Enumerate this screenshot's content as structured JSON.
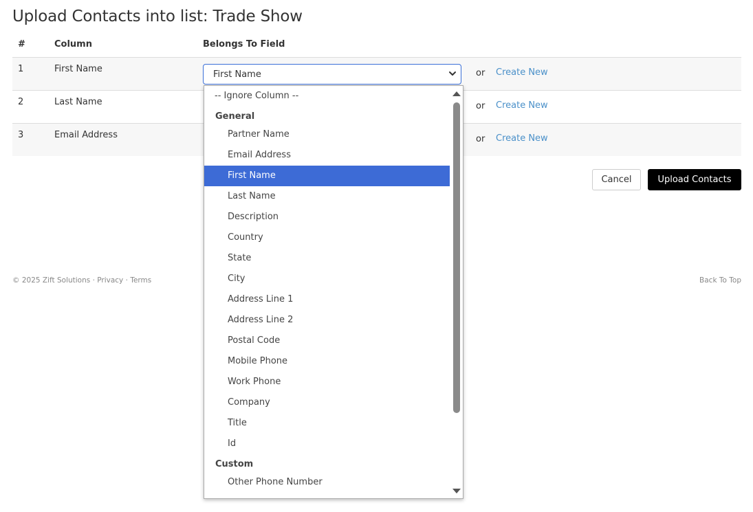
{
  "page": {
    "title": "Upload Contacts into list: Trade Show"
  },
  "table": {
    "headers": {
      "num": "#",
      "column": "Column",
      "field": "Belongs To Field"
    },
    "rows": [
      {
        "num": "1",
        "column": "First Name",
        "selected_field": "First Name",
        "or": "or",
        "create_new": "Create New"
      },
      {
        "num": "2",
        "column": "Last Name",
        "or": "or",
        "create_new": "Create New"
      },
      {
        "num": "3",
        "column": "Email Address",
        "or": "or",
        "create_new": "Create New"
      }
    ]
  },
  "actions": {
    "cancel": "Cancel",
    "upload": "Upload Contacts"
  },
  "footer": {
    "copyright": "© 2025 Zift Solutions",
    "sep": "·",
    "privacy": "Privacy",
    "terms": "Terms",
    "back_to_top": "Back To Top"
  },
  "dropdown": {
    "ignore": "-- Ignore Column --",
    "groups": [
      {
        "label": "General",
        "options": [
          "Partner Name",
          "Email Address",
          "First Name",
          "Last Name",
          "Description",
          "Country",
          "State",
          "City",
          "Address Line 1",
          "Address Line 2",
          "Postal Code",
          "Mobile Phone",
          "Work Phone",
          "Company",
          "Title",
          "Id"
        ]
      },
      {
        "label": "Custom",
        "options": [
          "Other Phone Number"
        ]
      }
    ],
    "highlighted": "First Name"
  },
  "colors": {
    "link": "#4a90c9",
    "selected_bg": "#3d6bd6",
    "primary_button": "#000000"
  }
}
